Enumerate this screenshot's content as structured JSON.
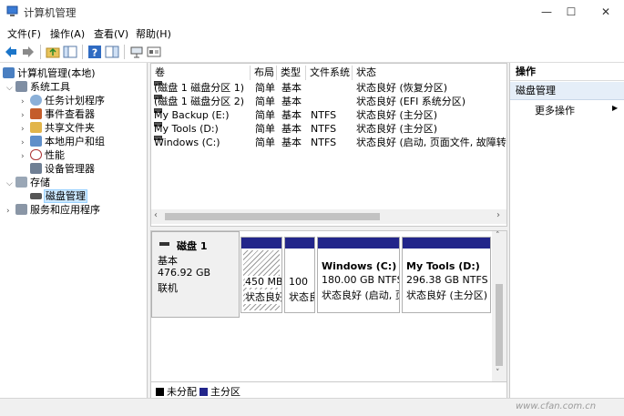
{
  "window": {
    "title": "计算机管理",
    "min": "—",
    "max": "☐",
    "close": "✕"
  },
  "menu": [
    "文件(F)",
    "操作(A)",
    "查看(V)",
    "帮助(H)"
  ],
  "tree": {
    "root": "计算机管理(本地)",
    "system_tools": "系统工具",
    "task_scheduler": "任务计划程序",
    "event_viewer": "事件查看器",
    "shared_folders": "共享文件夹",
    "local_users": "本地用户和组",
    "performance": "性能",
    "device_manager": "设备管理器",
    "storage": "存储",
    "disk_management": "磁盘管理",
    "services": "服务和应用程序"
  },
  "volume_table": {
    "headers": {
      "volume": "卷",
      "layout": "布局",
      "type": "类型",
      "fs": "文件系统",
      "status": "状态"
    },
    "rows": [
      {
        "volume": "(磁盘 1 磁盘分区 1)",
        "layout": "简单",
        "type": "基本",
        "fs": "",
        "status": "状态良好 (恢复分区)"
      },
      {
        "volume": "(磁盘 1 磁盘分区 2)",
        "layout": "简单",
        "type": "基本",
        "fs": "",
        "status": "状态良好 (EFI 系统分区)"
      },
      {
        "volume": "My Backup (E:)",
        "layout": "简单",
        "type": "基本",
        "fs": "NTFS",
        "status": "状态良好 (主分区)"
      },
      {
        "volume": "My Tools (D:)",
        "layout": "简单",
        "type": "基本",
        "fs": "NTFS",
        "status": "状态良好 (主分区)"
      },
      {
        "volume": "Windows (C:)",
        "layout": "简单",
        "type": "基本",
        "fs": "NTFS",
        "status": "状态良好 (启动, 页面文件, 故障转储,"
      }
    ]
  },
  "disk": {
    "name": "磁盘 1",
    "kind": "基本",
    "size": "476.92 GB",
    "state": "联机",
    "partitions": [
      {
        "line1": "450 MB",
        "line2": "状态良好"
      },
      {
        "line1": "100",
        "line2": "状态良"
      },
      {
        "title": "Windows  (C:)",
        "line1": "180.00 GB NTFS",
        "line2": "状态良好 (启动, 页"
      },
      {
        "title": "My Tools  (D:)",
        "line1": "296.38 GB NTFS",
        "line2": "状态良好 (主分区)"
      }
    ]
  },
  "legend": {
    "unallocated": "未分配",
    "primary": "主分区"
  },
  "actions": {
    "header": "操作",
    "section": "磁盘管理",
    "more": "更多操作",
    "more_arrow": "▶"
  },
  "watermark": "www.cfan.com.cn",
  "colors": {
    "primary_partition": "#22258a",
    "unallocated": "#000000",
    "selection": "#cce8ff"
  }
}
